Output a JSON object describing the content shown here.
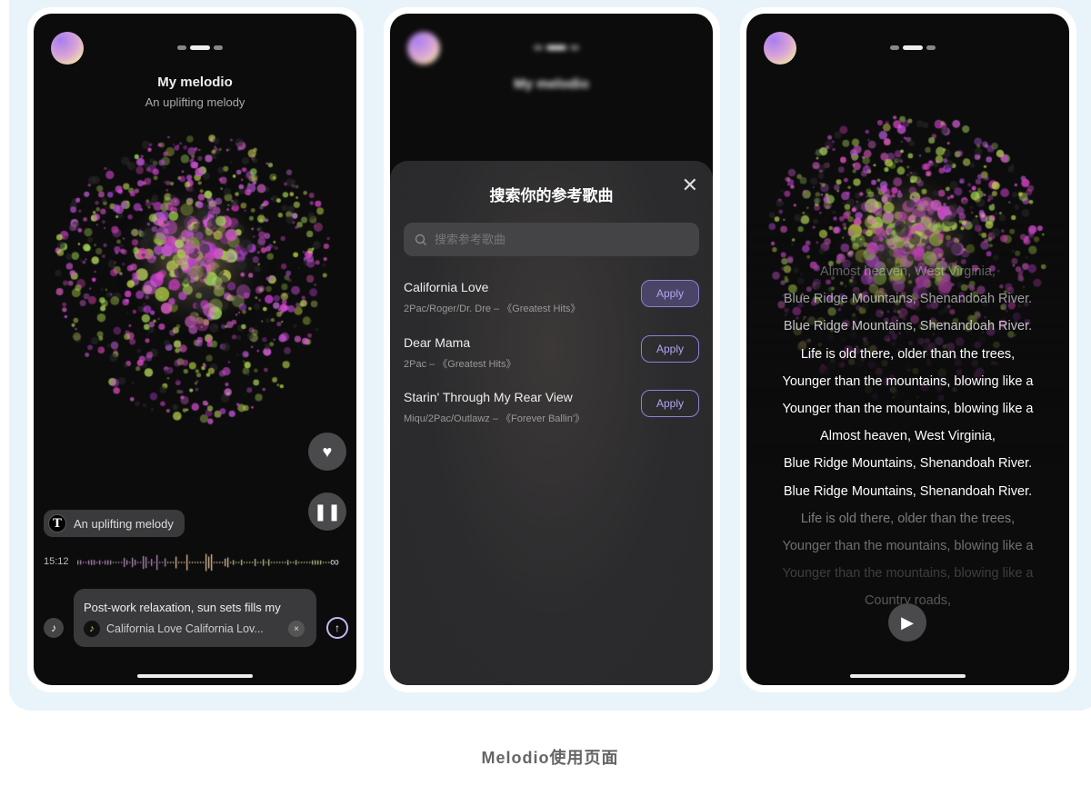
{
  "caption": "Melodio使用页面",
  "colors": {
    "accent": "#8f80d6",
    "backdrop": "#e9f4fa",
    "screen": "#0c0c0d",
    "particle_purple": "#b34fc4",
    "particle_green": "#b6e05a"
  },
  "screen1": {
    "title": "My melodio",
    "subtitle": "An uplifting melody",
    "page_indicator": {
      "count": 3,
      "active": 2
    },
    "favorite_icon": "heart-download-icon",
    "pause_icon": "pause-icon",
    "style_chip": {
      "icon": "T",
      "label": "An uplifting melody"
    },
    "time": "15:12",
    "loop_icon": "∞",
    "prompt": "Post-work relaxation, sun sets fills my",
    "reference_song": "California Love California Lov...",
    "remove_icon": "×",
    "send_icon": "↑"
  },
  "screen2": {
    "background_title": "My melodio",
    "modal": {
      "title": "搜索你的参考歌曲",
      "close_icon": "✕",
      "search_placeholder": "搜索参考歌曲",
      "search_value": "",
      "results": [
        {
          "name": "California Love",
          "meta": "2Pac/Roger/Dr. Dre – 《Greatest Hits》",
          "action": "Apply",
          "active": true
        },
        {
          "name": "Dear Mama",
          "meta": "2Pac – 《Greatest Hits》",
          "action": "Apply",
          "active": false
        },
        {
          "name": "Starin' Through My Rear View",
          "meta": "Miqu/2Pac/Outlawz – 《Forever Ballin'》",
          "action": "Apply",
          "active": false
        }
      ]
    }
  },
  "screen3": {
    "lyrics": [
      {
        "text": "Almost heaven, West Virginia,",
        "opacity": 0.35
      },
      {
        "text": "Blue Ridge Mountains, Shenandoah River.",
        "opacity": 0.6
      },
      {
        "text": "Blue Ridge Mountains, Shenandoah River.",
        "opacity": 0.75
      },
      {
        "text": "Life is old there, older than the trees,",
        "opacity": 1
      },
      {
        "text": "Younger than the mountains, blowing like a",
        "opacity": 1
      },
      {
        "text": "Younger than the mountains, blowing like a",
        "opacity": 1
      },
      {
        "text": "Almost heaven, West Virginia,",
        "opacity": 1
      },
      {
        "text": "Blue Ridge Mountains, Shenandoah River.",
        "opacity": 1
      },
      {
        "text": "Blue Ridge Mountains, Shenandoah River.",
        "opacity": 1
      },
      {
        "text": "Life is old there, older than the trees,",
        "opacity": 0.45
      },
      {
        "text": "Younger than the mountains, blowing like a",
        "opacity": 0.4
      },
      {
        "text": "Younger than the mountains, blowing like a",
        "opacity": 0.2
      },
      {
        "text": "Country roads,",
        "opacity": 0.3
      }
    ],
    "play_icon": "▶"
  }
}
